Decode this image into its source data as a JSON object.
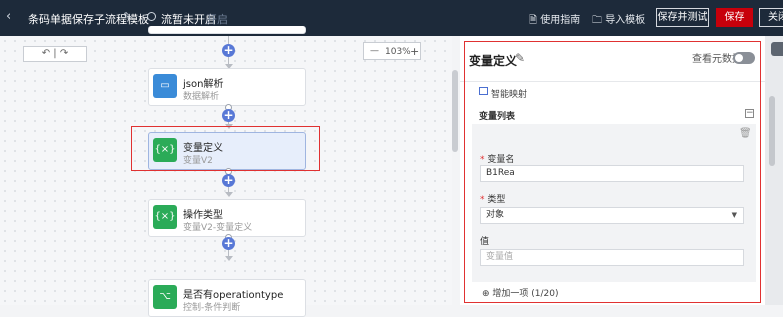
{
  "topbar": {
    "back_icon": "‹",
    "title": "条码单据保存子流程模板",
    "edit_icon": "✎",
    "flow_status": "流暂未开启",
    "flow_toggle": "开启",
    "guide": "使用指南",
    "import": "导入模板",
    "save_test": "保存并测试",
    "save": "保存",
    "close": "关闭",
    "save_color": "#c7000b"
  },
  "canvas": {
    "undo_redo": "↶ | ↷",
    "zoom": {
      "minus": "—",
      "value": "103%",
      "plus": "+"
    },
    "nodes": [
      {
        "name": "json解析",
        "sub": "数据解析",
        "icon": "monitor-icon",
        "color": "#3a8bd8"
      },
      {
        "name": "变量定义",
        "sub": "变量V2",
        "icon": "braces-icon",
        "color": "#2bab58"
      },
      {
        "name": "操作类型",
        "sub": "变量V2-变量定义",
        "icon": "braces-icon",
        "color": "#2bab58"
      },
      {
        "name": "是否有operationtype",
        "sub": "控制-条件判断",
        "icon": "branch-icon",
        "color": "#2bab58"
      }
    ],
    "plus": "+"
  },
  "panel": {
    "title": "变量定义",
    "edit_icon": "✎",
    "meta_label": "查看元数据",
    "smart_mapping": "智能映射",
    "var_list": "变量列表",
    "collapse": "−",
    "trash_icon": "🗑",
    "var_name_label": "变量名",
    "var_name_value": "B1Rea",
    "type_label": "类型",
    "type_value": "对象",
    "value_label": "值",
    "value_placeholder": "变量值",
    "add_item": "⊕ 增加一项 (1/20)",
    "required_mark": "*"
  }
}
